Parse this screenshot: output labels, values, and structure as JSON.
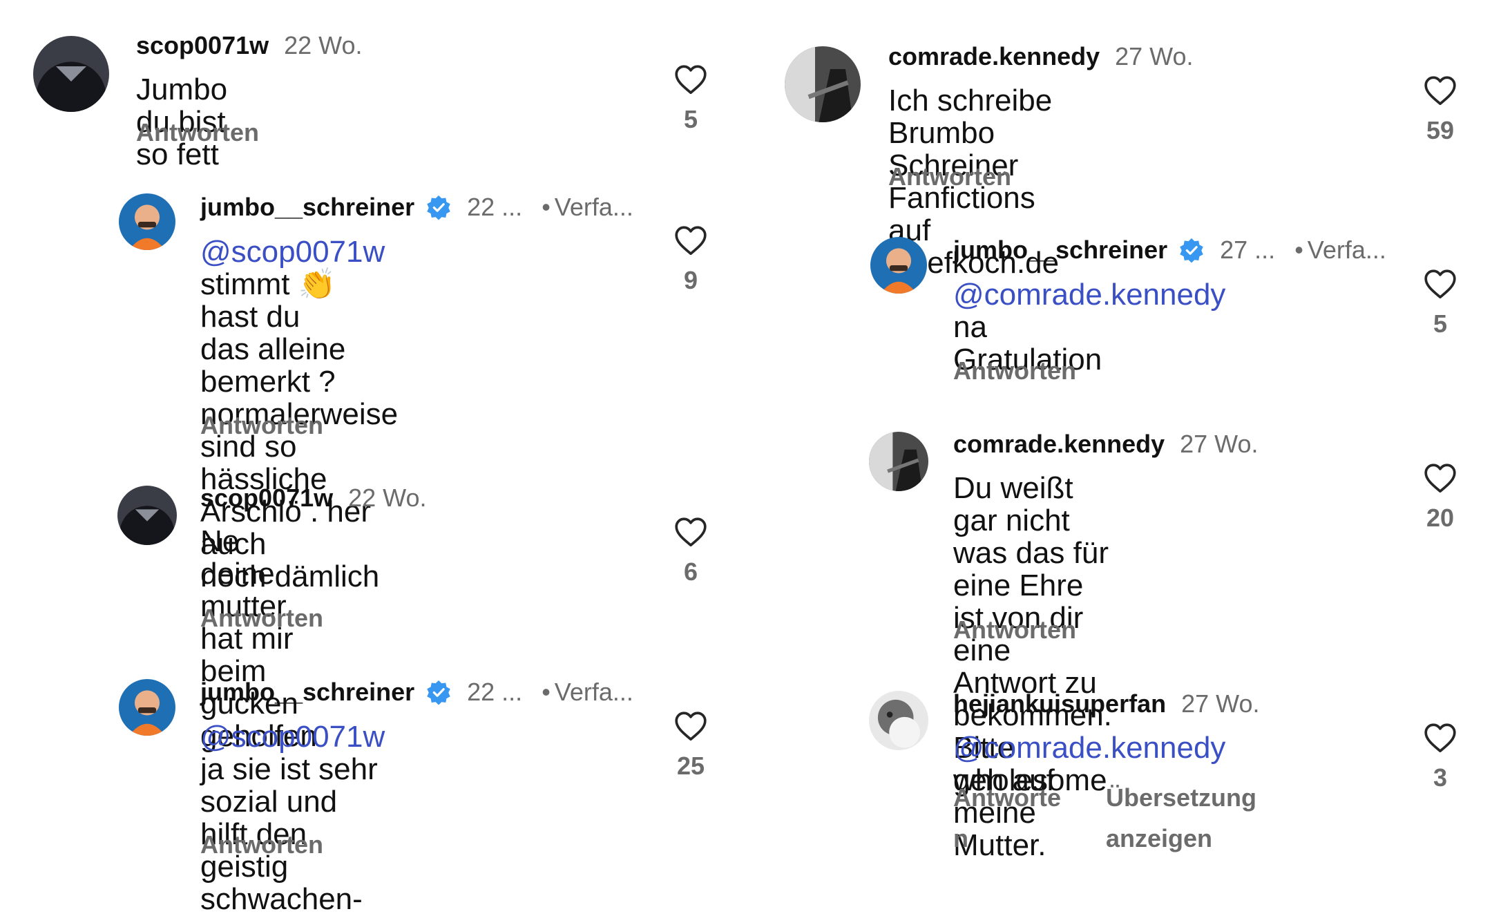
{
  "left": {
    "c1": {
      "username": "scop0071w",
      "time": "22 Wo.",
      "text": "Jumbo du bist so fett",
      "reply": "Antworten",
      "likes": "5"
    },
    "c2": {
      "username": "jumbo__schreiner",
      "time": "22 ...",
      "author": "Verfa...",
      "mention": "@scop0071w",
      "line1_rest": " stimmt ",
      "emoji": "👏",
      "line1_tail": " hast du",
      "lines": [
        "das alleine bemerkt ?",
        "normalerweise sind so",
        "hässliche Arschlö . her auch",
        "noch dämlich"
      ],
      "reply": "Antworten",
      "likes": "9"
    },
    "c3": {
      "username": "scop0071w",
      "time": "22 Wo.",
      "lines": [
        "Ne deine mutter hat mir beim",
        "gucken geholfen"
      ],
      "reply": "Antworten",
      "likes": "6"
    },
    "c4": {
      "username": "jumbo__schreiner",
      "time": "22 ...",
      "author": "Verfa...",
      "mention": "@scop0071w",
      "line1_rest": " ja sie ist sehr",
      "lines": [
        "sozial und hilft den geistig",
        "schwachen-"
      ],
      "reply": "Antworten",
      "likes": "25"
    }
  },
  "right": {
    "c1": {
      "username": "comrade.kennedy",
      "time": "27 Wo.",
      "lines": [
        "Ich schreibe Brumbo Schreiner",
        "Fanfictions auf Chefkoch.de"
      ],
      "reply": "Antworten",
      "likes": "59"
    },
    "c2": {
      "username": "jumbo__schreiner",
      "time": "27 ...",
      "author": "Verfa...",
      "mention": "@comrade.kennedy",
      "line1_rest": " na",
      "lines": [
        "Gratulation"
      ],
      "reply": "Antworten",
      "likes": "5"
    },
    "c3": {
      "username": "comrade.kennedy",
      "time": "27 Wo.",
      "lines": [
        "Du weißt gar nicht was das für",
        "eine Ehre ist von dir eine",
        "Antwort zu bekommen. Bitte",
        "geh auf meine Mutter."
      ],
      "reply": "Antworten",
      "likes": "20"
    },
    "c4": {
      "username": "hejiankuisuperfan",
      "time": "27 Wo.",
      "mention": "@comrade.kennedy",
      "line1_rest": " wholesome",
      "reply_l1": "Antworte",
      "reply_l2": "n",
      "translate_l1": "Übersetzung",
      "translate_l2": "anzeigen",
      "likes": "3"
    }
  },
  "colors": {
    "mention": "#3b4fc4",
    "verified": "#3897f0",
    "muted": "#6b6b6b"
  },
  "icons": {
    "like": "heart-outline-icon",
    "verified": "verified-badge-icon"
  }
}
